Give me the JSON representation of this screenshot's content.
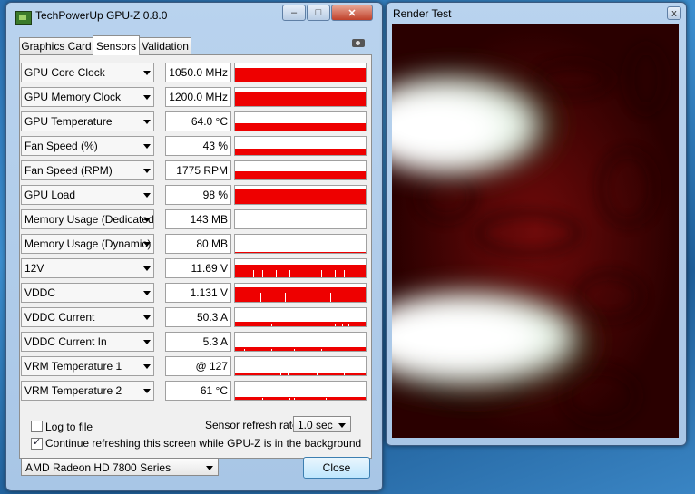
{
  "gpuz": {
    "title": "TechPowerUp GPU-Z 0.8.0",
    "tabs": [
      "Graphics Card",
      "Sensors",
      "Validation"
    ],
    "active_tab": "Sensors",
    "sensors": [
      {
        "name": "GPU Core Clock",
        "value": "1050.0 MHz",
        "level": 0.75,
        "spikes": []
      },
      {
        "name": "GPU Memory Clock",
        "value": "1200.0 MHz",
        "level": 0.75,
        "spikes": []
      },
      {
        "name": "GPU Temperature",
        "value": "64.0 °C",
        "level": 0.4,
        "spikes": []
      },
      {
        "name": "Fan Speed (%)",
        "value": "43 %",
        "level": 0.35,
        "spikes": []
      },
      {
        "name": "Fan Speed (RPM)",
        "value": "1775 RPM",
        "level": 0.45,
        "spikes": []
      },
      {
        "name": "GPU Load",
        "value": "98 %",
        "level": 0.85,
        "spikes": []
      },
      {
        "name": "Memory Usage (Dedicated)",
        "value": "143 MB",
        "level": 0.05,
        "spikes": []
      },
      {
        "name": "Memory Usage (Dynamic)",
        "value": "80 MB",
        "level": 0.03,
        "spikes": []
      },
      {
        "name": "12V",
        "value": "11.69 V",
        "level": 0.7,
        "spikes": [
          20,
          30,
          45,
          60,
          70,
          80,
          95,
          110,
          120
        ]
      },
      {
        "name": "VDDC",
        "value": "1.131 V",
        "level": 0.8,
        "spikes": [
          28,
          55,
          80,
          105
        ]
      },
      {
        "name": "VDDC Current",
        "value": "50.3 A",
        "level": 0.25,
        "spikes": [
          5,
          40,
          70,
          110,
          118,
          125
        ]
      },
      {
        "name": "VDDC Current In",
        "value": "5.3 A",
        "level": 0.2,
        "spikes": [
          10,
          40,
          65,
          95
        ]
      },
      {
        "name": "VRM Temperature 1",
        "value": "@ 127",
        "level": 0.15,
        "spikes": [
          50,
          58,
          90,
          120
        ]
      },
      {
        "name": "VRM Temperature 2",
        "value": "61 °C",
        "level": 0.15,
        "spikes": [
          30,
          60,
          65,
          100
        ]
      }
    ],
    "log_to_file": "Log to file",
    "log_to_file_checked": false,
    "refresh_label": "Sensor refresh rate:",
    "refresh_value": "1.0 sec",
    "continue_label": "Continue refreshing this screen while GPU-Z is in the background",
    "continue_checked": true,
    "gpu_select": "AMD Radeon HD 7800 Series",
    "close_label": "Close",
    "accent_color": "#ee0000"
  },
  "render": {
    "title": "Render Test"
  }
}
